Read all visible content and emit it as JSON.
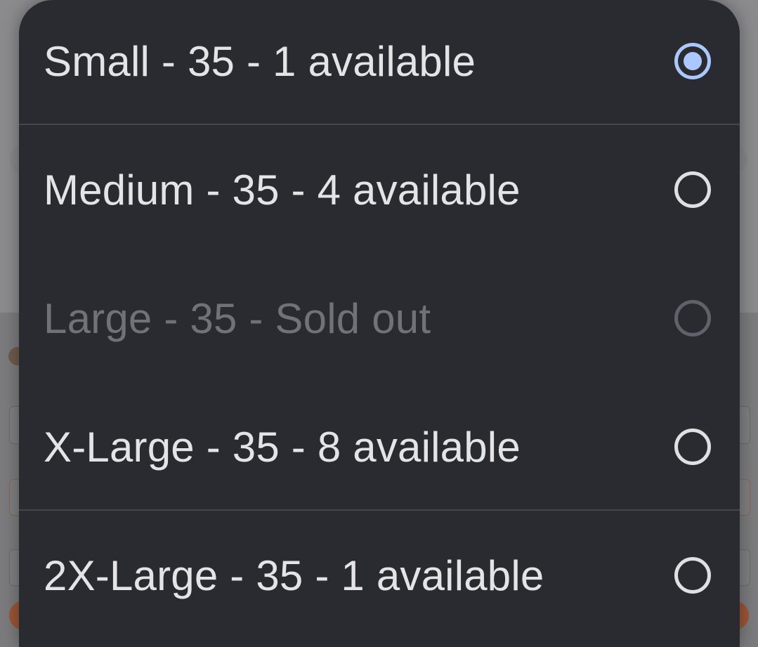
{
  "dialog": {
    "options": [
      {
        "label": "Small - 35 - 1 available",
        "selected": true,
        "enabled": true
      },
      {
        "label": "Medium - 35 - 4 available",
        "selected": false,
        "enabled": true
      },
      {
        "label": "Large - 35 - Sold out",
        "selected": false,
        "enabled": false
      },
      {
        "label": "X-Large - 35 - 8 available",
        "selected": false,
        "enabled": true
      },
      {
        "label": "2X-Large - 35 - 1 available",
        "selected": false,
        "enabled": true
      }
    ]
  },
  "colors": {
    "sheet_background": "#2a2b30",
    "selected_accent": "#abc7ff",
    "text": "#e4e3e8",
    "disabled_text": "#717278",
    "backdrop_button": "#9b5535"
  }
}
